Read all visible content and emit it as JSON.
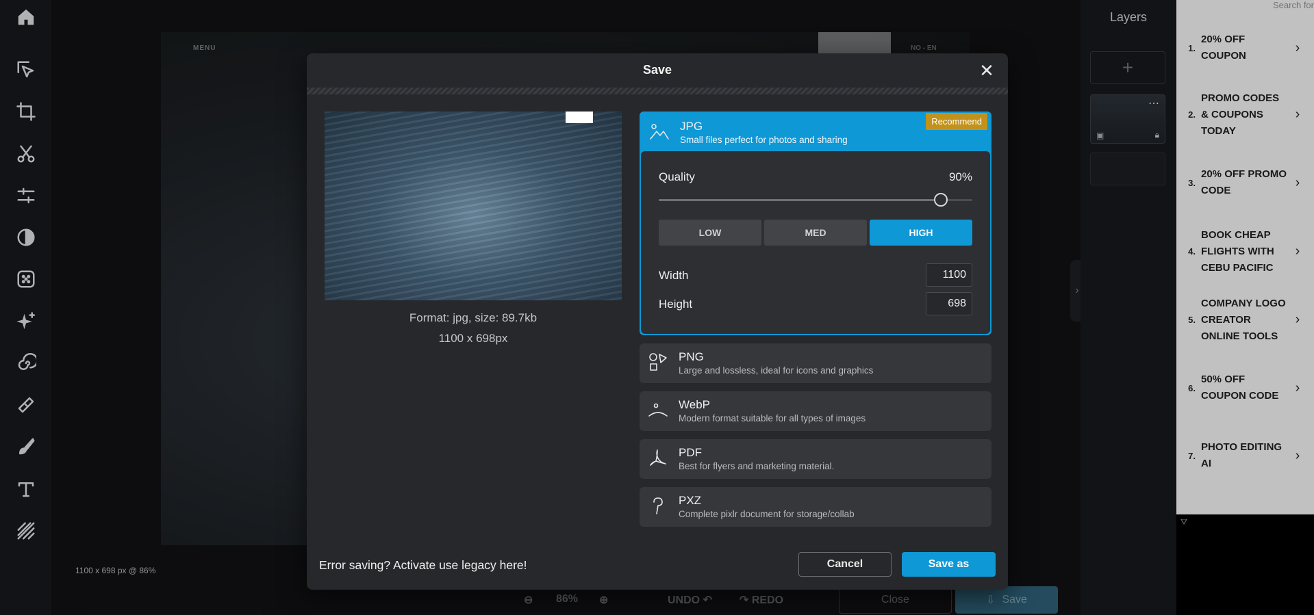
{
  "toolbar": {
    "tools": [
      "home-icon",
      "arrange-select-icon",
      "crop-icon",
      "cut-icon",
      "adjust-icon",
      "filter-icon",
      "effect-icon",
      "ai-icon",
      "liquify-icon",
      "heal-icon",
      "brush-icon",
      "text-icon",
      "pattern-icon"
    ]
  },
  "canvas": {
    "menu_text": "MENU",
    "lang_text": "NO - EN",
    "status": "1100 x 698 px @ 86%"
  },
  "bottombar": {
    "zoom": "86%",
    "undo": "UNDO",
    "redo": "REDO",
    "close": "Close",
    "save": "Save"
  },
  "layers": {
    "title": "Layers",
    "add": "+"
  },
  "ad": {
    "search": "Search for",
    "items": [
      {
        "num": "1.",
        "text": "20% OFF COUPON"
      },
      {
        "num": "2.",
        "text": "PROMO CODES & COUPONS TODAY"
      },
      {
        "num": "3.",
        "text": "20% OFF PROMO CODE"
      },
      {
        "num": "4.",
        "text": "BOOK CHEAP FLIGHTS WITH CEBU PACIFIC"
      },
      {
        "num": "5.",
        "text": "COMPANY LOGO CREATOR ONLINE TOOLS"
      },
      {
        "num": "6.",
        "text": "50% OFF COUPON CODE"
      },
      {
        "num": "7.",
        "text": "PHOTO EDITING AI"
      }
    ]
  },
  "dialog": {
    "title": "Save",
    "close": "✕",
    "preview": {
      "format_line": "Format: jpg, size: 89.7kb",
      "size_line": "1100 x 698px"
    },
    "formats": {
      "jpg": {
        "name": "JPG",
        "desc": "Small files perfect for photos and sharing",
        "badge": "Recommend"
      },
      "png": {
        "name": "PNG",
        "desc": "Large and lossless, ideal for icons and graphics"
      },
      "webp": {
        "name": "WebP",
        "desc": "Modern format suitable for all types of images"
      },
      "pdf": {
        "name": "PDF",
        "desc": "Best for flyers and marketing material."
      },
      "pxz": {
        "name": "PXZ",
        "desc": "Complete pixlr document for storage/collab"
      }
    },
    "quality": {
      "label": "Quality",
      "value_text": "90%",
      "value": 0.9,
      "low": "LOW",
      "med": "MED",
      "high": "HIGH"
    },
    "width": {
      "label": "Width",
      "value": "1100"
    },
    "height": {
      "label": "Height",
      "value": "698"
    },
    "legacy": "Error saving? Activate use legacy here!",
    "cancel": "Cancel",
    "save_as": "Save as"
  }
}
